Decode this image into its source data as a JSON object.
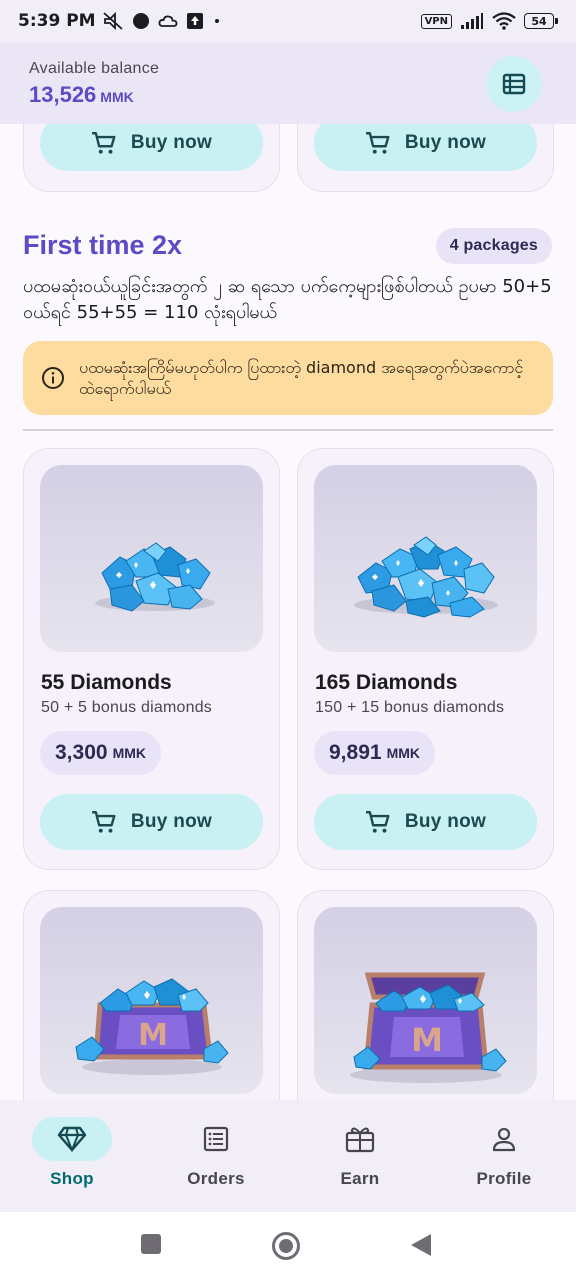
{
  "status_bar": {
    "time": "5:39 PM",
    "vpn": "VPN",
    "battery": "54"
  },
  "balance": {
    "label": "Available balance",
    "amount": "13,526",
    "currency": "MMK",
    "orders_icon": "receipt-list-icon"
  },
  "top_row": {
    "buy_left": "Buy now",
    "buy_right": "Buy now"
  },
  "section": {
    "title": "First time 2x",
    "count": "4 packages",
    "description": "ပထမဆုံးဝယ်ယူခြင်းအတွက် ၂ ဆ ရသော ပက်ကေ့များဖြစ်ပါတယ်   ဥပမာ   50+5 ဝယ်ရင်   55+55 = 110 လုံးရပါမယ်",
    "notice": "ပထမဆုံးအကြိမ်မဟုတ်ပါက ပြထားတဲ့ diamond အရေအတွက်ပဲအကောင့်ထဲရောက်ပါမယ်",
    "notice_icon": "info-icon"
  },
  "packages": [
    {
      "title": "55 Diamonds",
      "subtitle": "50 + 5 bonus diamonds",
      "price": "3,300",
      "currency": "MMK",
      "button": "Buy now"
    },
    {
      "title": "165 Diamonds",
      "subtitle": "150 + 15 bonus diamonds",
      "price": "9,891",
      "currency": "MMK",
      "button": "Buy now"
    }
  ],
  "bottom_nav": [
    {
      "label": "Shop",
      "icon": "diamond-icon",
      "active": true
    },
    {
      "label": "Orders",
      "icon": "orders-icon",
      "active": false
    },
    {
      "label": "Earn",
      "icon": "gift-icon",
      "active": false
    },
    {
      "label": "Profile",
      "icon": "person-icon",
      "active": false
    }
  ],
  "colors": {
    "accent": "#5b4bc4",
    "teal_button": "#c9f1f3",
    "notice_bg": "#fedb9f",
    "active_nav_text": "#006971"
  }
}
